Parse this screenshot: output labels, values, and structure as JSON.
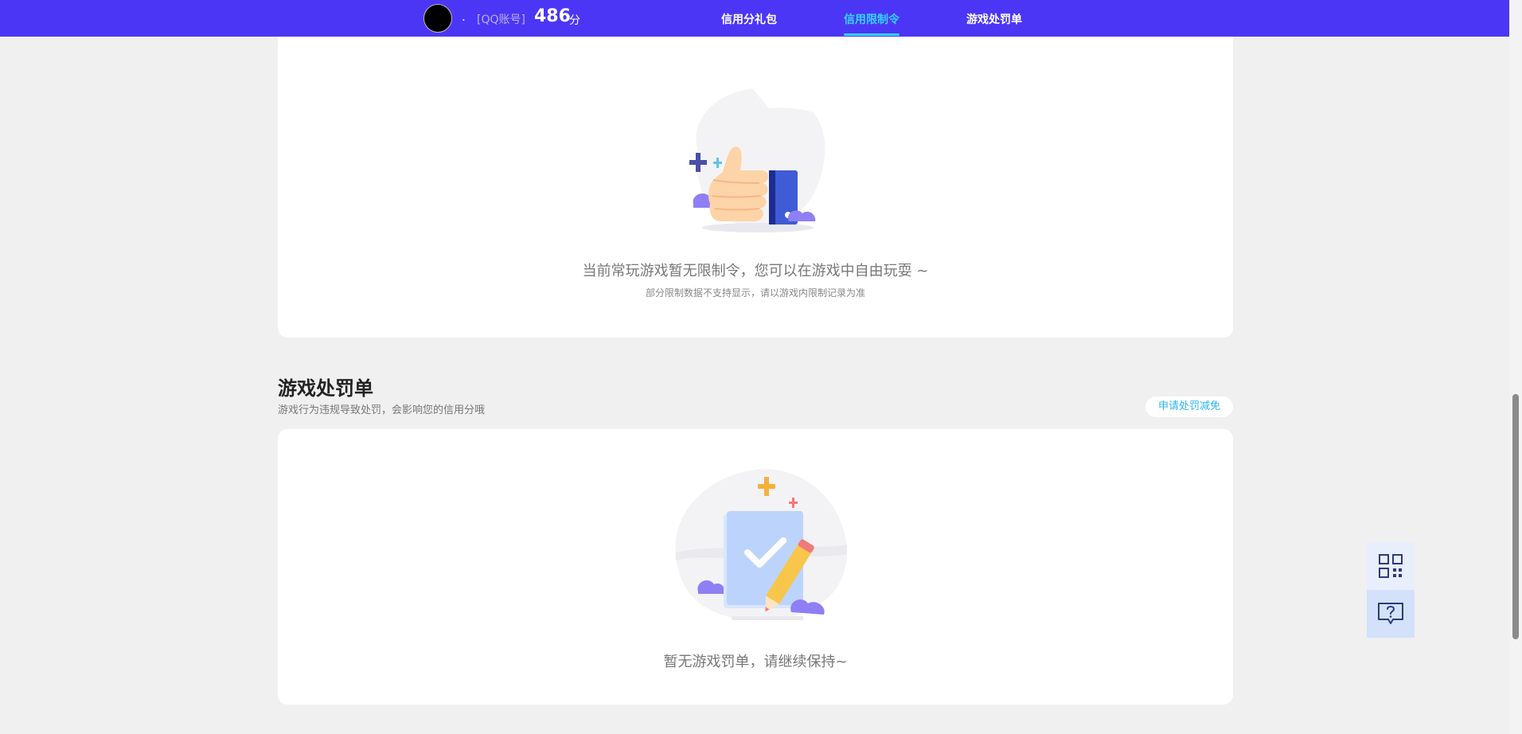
{
  "header": {
    "nickname": ".",
    "account_type": "[QQ账号]",
    "score": "486",
    "score_unit": "分",
    "nav": [
      {
        "label": "信用分礼包",
        "active": false
      },
      {
        "label": "信用限制令",
        "active": true
      },
      {
        "label": "游戏处罚单",
        "active": false
      }
    ]
  },
  "restriction": {
    "empty_message": "当前常玩游戏暂无限制令，您可以在游戏中自由玩耍 ~",
    "note": "部分限制数据不支持显示，请以游戏内限制记录为准"
  },
  "penalty": {
    "title": "游戏处罚单",
    "description": "游戏行为违规导致处罚，会影响您的信用分哦",
    "apply_button": "申请处罚减免",
    "empty_message": "暂无游戏罚单，请继续保持~"
  },
  "float_buttons": {
    "qr_icon": "qr-code-icon",
    "help_icon": "help-chat-icon"
  },
  "colors": {
    "header_bg": "#4b36f5",
    "nav_active": "#35d4ff",
    "accent_link": "#2cb5f5",
    "page_bg": "#f0f0f0"
  }
}
